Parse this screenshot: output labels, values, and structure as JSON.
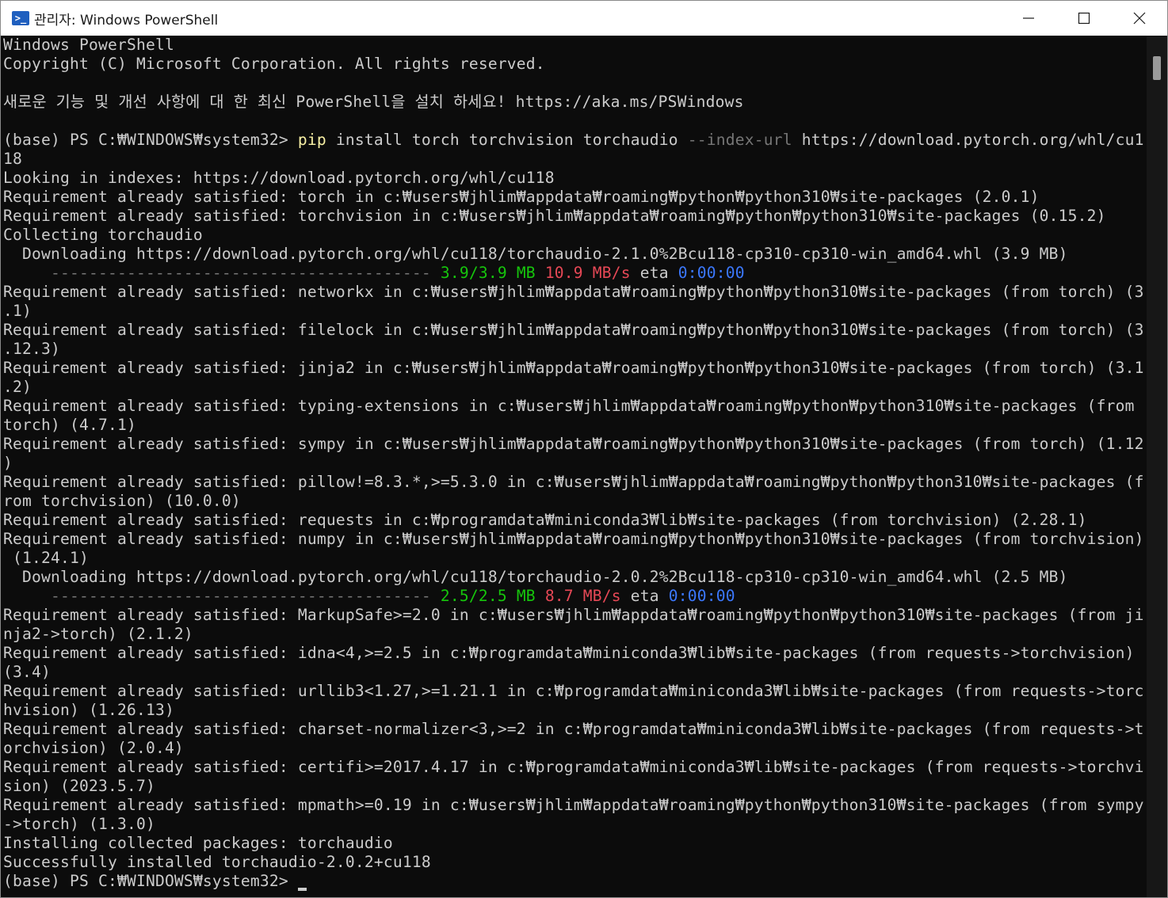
{
  "window": {
    "title": "관리자: Windows PowerShell",
    "icon": "powershell-icon",
    "controls": [
      "minimize-icon",
      "maximize-icon",
      "close-icon"
    ]
  },
  "colors": {
    "background": "#0c0c0c",
    "text": "#cccccc",
    "command": "#f9f1a5",
    "parameter": "#767676",
    "progress_size": "#16c60c",
    "progress_speed": "#e74856",
    "progress_eta": "#3b78ff"
  },
  "console": {
    "l01": "Windows PowerShell",
    "l02": "Copyright (C) Microsoft Corporation. All rights reserved.",
    "l04": "새로운 기능 및 개선 사항에 대 한 최신 PowerShell을 설치 하세요! https://aka.ms/PSWindows",
    "l06_prompt": "(base) PS C:₩WINDOWS₩system32> ",
    "l06_cmd": "pip",
    "l06_args": " install torch torchvision torchaudio ",
    "l06_param": "--index-url",
    "l06_url": " https://download.pytorch.org/whl/cu1",
    "l07": "18",
    "l08": "Looking in indexes: https://download.pytorch.org/whl/cu118",
    "l09": "Requirement already satisfied: torch in c:₩users₩jhlim₩appdata₩roaming₩python₩python310₩site-packages (2.0.1)",
    "l10": "Requirement already satisfied: torchvision in c:₩users₩jhlim₩appdata₩roaming₩python₩python310₩site-packages (0.15.2)",
    "l11": "Collecting torchaudio",
    "l12": "  Downloading https://download.pytorch.org/whl/cu118/torchaudio-2.1.0%2Bcu118-cp310-cp310-win_amd64.whl (3.9 MB)",
    "l13_bar": "     ---------------------------------------- ",
    "l13_size": "3.9/3.9 MB",
    "l13_speed": "10.9 MB/s",
    "l13_eta_label": " eta ",
    "l13_eta": "0:00:00",
    "l14": "Requirement already satisfied: networkx in c:₩users₩jhlim₩appdata₩roaming₩python₩python310₩site-packages (from torch) (3",
    "l15": ".1)",
    "l16": "Requirement already satisfied: filelock in c:₩users₩jhlim₩appdata₩roaming₩python₩python310₩site-packages (from torch) (3",
    "l17": ".12.3)",
    "l18": "Requirement already satisfied: jinja2 in c:₩users₩jhlim₩appdata₩roaming₩python₩python310₩site-packages (from torch) (3.1",
    "l19": ".2)",
    "l20": "Requirement already satisfied: typing-extensions in c:₩users₩jhlim₩appdata₩roaming₩python₩python310₩site-packages (from",
    "l21": "torch) (4.7.1)",
    "l22": "Requirement already satisfied: sympy in c:₩users₩jhlim₩appdata₩roaming₩python₩python310₩site-packages (from torch) (1.12",
    "l23": ")",
    "l24": "Requirement already satisfied: pillow!=8.3.*,>=5.3.0 in c:₩users₩jhlim₩appdata₩roaming₩python₩python310₩site-packages (f",
    "l25": "rom torchvision) (10.0.0)",
    "l26": "Requirement already satisfied: requests in c:₩programdata₩miniconda3₩lib₩site-packages (from torchvision) (2.28.1)",
    "l27": "Requirement already satisfied: numpy in c:₩users₩jhlim₩appdata₩roaming₩python₩python310₩site-packages (from torchvision)",
    "l28": " (1.24.1)",
    "l29": "  Downloading https://download.pytorch.org/whl/cu118/torchaudio-2.0.2%2Bcu118-cp310-cp310-win_amd64.whl (2.5 MB)",
    "l30_bar": "     ---------------------------------------- ",
    "l30_size": "2.5/2.5 MB",
    "l30_speed": "8.7 MB/s",
    "l30_eta_label": " eta ",
    "l30_eta": "0:00:00",
    "l31": "Requirement already satisfied: MarkupSafe>=2.0 in c:₩users₩jhlim₩appdata₩roaming₩python₩python310₩site-packages (from ji",
    "l32": "nja2->torch) (2.1.2)",
    "l33": "Requirement already satisfied: idna<4,>=2.5 in c:₩programdata₩miniconda3₩lib₩site-packages (from requests->torchvision)",
    "l34": "(3.4)",
    "l35": "Requirement already satisfied: urllib3<1.27,>=1.21.1 in c:₩programdata₩miniconda3₩lib₩site-packages (from requests->torc",
    "l36": "hvision) (1.26.13)",
    "l37": "Requirement already satisfied: charset-normalizer<3,>=2 in c:₩programdata₩miniconda3₩lib₩site-packages (from requests->t",
    "l38": "orchvision) (2.0.4)",
    "l39": "Requirement already satisfied: certifi>=2017.4.17 in c:₩programdata₩miniconda3₩lib₩site-packages (from requests->torchvi",
    "l40": "sion) (2023.5.7)",
    "l41": "Requirement already satisfied: mpmath>=0.19 in c:₩users₩jhlim₩appdata₩roaming₩python₩python310₩site-packages (from sympy",
    "l42": "->torch) (1.3.0)",
    "l43": "Installing collected packages: torchaudio",
    "l44": "Successfully installed torchaudio-2.0.2+cu118",
    "l45_prompt": "(base) PS C:₩WINDOWS₩system32> "
  }
}
